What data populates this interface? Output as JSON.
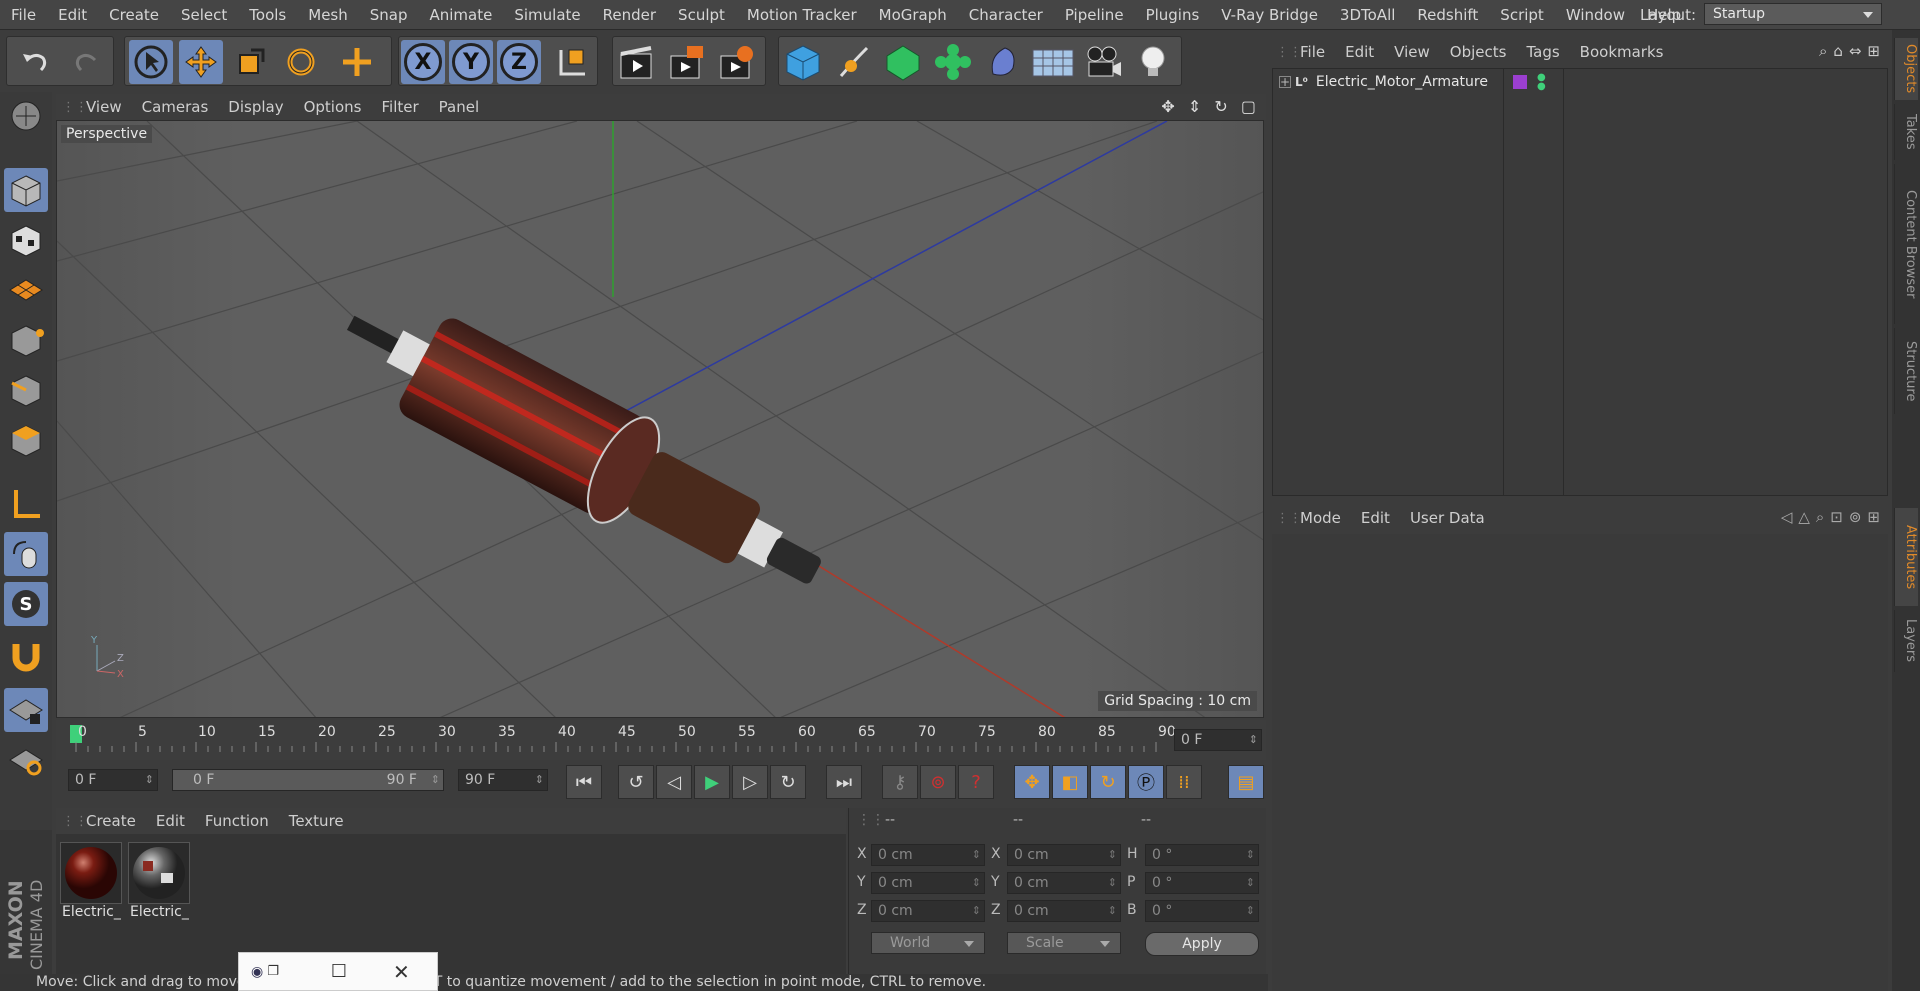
{
  "menubar": {
    "items": [
      "File",
      "Edit",
      "Create",
      "Select",
      "Tools",
      "Mesh",
      "Snap",
      "Animate",
      "Simulate",
      "Render",
      "Sculpt",
      "Motion Tracker",
      "MoGraph",
      "Character",
      "Pipeline",
      "Plugins",
      "V-Ray Bridge",
      "3DToAll",
      "Redshift",
      "Script",
      "Window",
      "Help"
    ],
    "layout_label": "Layout:",
    "layout_value": "Startup"
  },
  "toolbar": {
    "axis_x": "X",
    "axis_y": "Y",
    "axis_z": "Z"
  },
  "viewport": {
    "menu": [
      "View",
      "Cameras",
      "Display",
      "Options",
      "Filter",
      "Panel"
    ],
    "camera_label": "Perspective",
    "grid_spacing": "Grid Spacing : 10 cm",
    "gizmo": {
      "y": "Y",
      "z": "Z",
      "x": "X"
    }
  },
  "timeline": {
    "ticks": [
      "0",
      "5",
      "10",
      "15",
      "20",
      "25",
      "30",
      "35",
      "40",
      "45",
      "50",
      "55",
      "60",
      "65",
      "70",
      "75",
      "80",
      "85",
      "90"
    ],
    "current_frame": "0 F"
  },
  "transport": {
    "start": "0 F",
    "range_start": "0 F",
    "range_end": "90 F",
    "end": "90 F"
  },
  "material_manager": {
    "menu": [
      "Create",
      "Edit",
      "Function",
      "Texture"
    ],
    "materials": [
      {
        "label": "Electric_"
      },
      {
        "label": "Electric_"
      }
    ]
  },
  "coordinates": {
    "headers": [
      "--",
      "--",
      "--"
    ],
    "rows": [
      {
        "l1": "X",
        "v1": "0 cm",
        "l2": "X",
        "v2": "0 cm",
        "l3": "H",
        "v3": "0 °"
      },
      {
        "l1": "Y",
        "v1": "0 cm",
        "l2": "Y",
        "v2": "0 cm",
        "l3": "P",
        "v3": "0 °"
      },
      {
        "l1": "Z",
        "v1": "0 cm",
        "l2": "Z",
        "v2": "0 cm",
        "l3": "B",
        "v3": "0 °"
      }
    ],
    "space": "World",
    "mode": "Scale",
    "apply": "Apply"
  },
  "status": "Move: Click and drag to move elements. Hold down SHIFT to quantize movement / add to the selection in point mode, CTRL to remove.",
  "object_manager": {
    "menu": [
      "File",
      "Edit",
      "View",
      "Objects",
      "Tags",
      "Bookmarks"
    ],
    "object_name": "Electric_Motor_Armature",
    "layer_color": "#9b3fd0",
    "tag_color": "#3fd07a"
  },
  "attribute_manager": {
    "menu": [
      "Mode",
      "Edit",
      "User Data"
    ]
  },
  "side_tabs": {
    "top": [
      "Objects",
      "Takes",
      "Content Browser",
      "Structure"
    ],
    "bottom": [
      "Attributes",
      "Layers"
    ]
  },
  "brand": {
    "maxon": "MAXON",
    "product": "CINEMA 4D"
  },
  "colors": {
    "accent": "#6d88b8",
    "orange": "#e08a2a",
    "bg": "#3c3c3c"
  }
}
